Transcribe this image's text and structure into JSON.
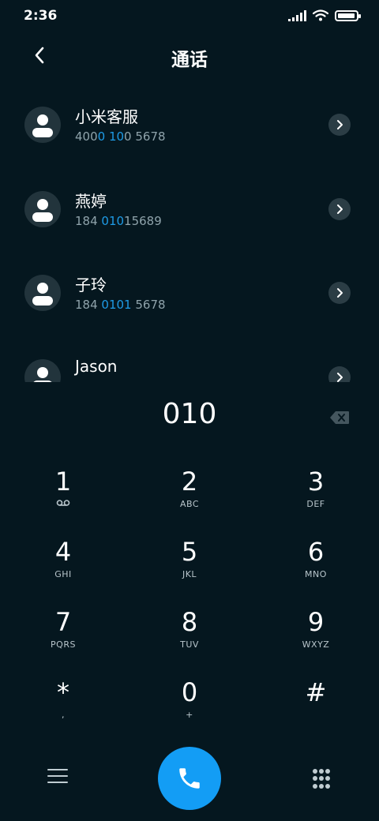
{
  "status_bar": {
    "time": "2:36",
    "battery_level": 0.95
  },
  "header": {
    "title": "通话"
  },
  "contacts": [
    {
      "name": "小米客服",
      "number_parts": [
        "400",
        "0 10",
        "0 5678"
      ]
    },
    {
      "name": "燕婷",
      "number_parts": [
        "184 ",
        "010",
        "15689"
      ]
    },
    {
      "name": "子玲",
      "number_parts": [
        "184 ",
        "0101",
        " 5678"
      ]
    },
    {
      "name": "Jason",
      "number_parts": [
        "",
        "",
        ""
      ]
    }
  ],
  "dialer": {
    "input": "010"
  },
  "keypad": [
    {
      "digit": "1",
      "letters": ""
    },
    {
      "digit": "2",
      "letters": "ABC"
    },
    {
      "digit": "3",
      "letters": "DEF"
    },
    {
      "digit": "4",
      "letters": "GHI"
    },
    {
      "digit": "5",
      "letters": "JKL"
    },
    {
      "digit": "6",
      "letters": "MNO"
    },
    {
      "digit": "7",
      "letters": "PQRS"
    },
    {
      "digit": "8",
      "letters": "TUV"
    },
    {
      "digit": "9",
      "letters": "WXYZ"
    },
    {
      "digit": "*",
      "letters": ","
    },
    {
      "digit": "0",
      "letters": "+"
    },
    {
      "digit": "#",
      "letters": ""
    }
  ],
  "icons": {
    "back": "chevron-left-icon",
    "backspace": "backspace-icon",
    "voicemail": "voicemail-icon",
    "call": "phone-icon",
    "menu": "menu-icon",
    "dialpad": "dialpad-icon"
  },
  "colors": {
    "background": "#05171f",
    "accent": "#139df5",
    "highlight": "#1e9be6"
  }
}
